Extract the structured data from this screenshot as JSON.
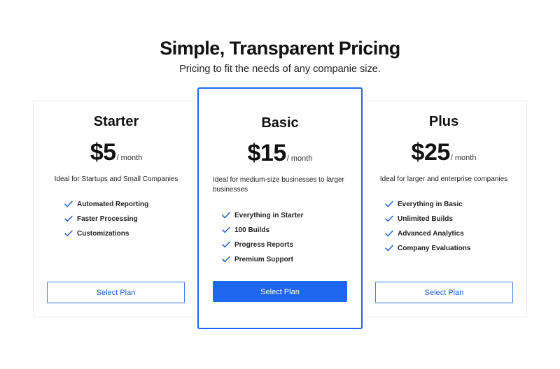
{
  "header": {
    "title": "Simple, Transparent Pricing",
    "subtitle": "Pricing to fit the needs of any companie size."
  },
  "colors": {
    "accent": "#1f66ef",
    "check": "#1f5fd6",
    "card_border": "#e7e9ec"
  },
  "plans": [
    {
      "name": "Starter",
      "price": "$5",
      "period": "/ month",
      "description": "Ideal for Startups and Small Companies",
      "features": [
        "Automated Reporting",
        "Faster Processing",
        "Customizations"
      ],
      "button_label": "Select Plan",
      "featured": false
    },
    {
      "name": "Basic",
      "price": "$15",
      "period": "/ month",
      "description": "Ideal for medium-size businesses to larger businesses",
      "features": [
        "Everything in Starter",
        "100 Builds",
        "Progress Reports",
        "Premium Support"
      ],
      "button_label": "Select Plan",
      "featured": true
    },
    {
      "name": "Plus",
      "price": "$25",
      "period": "/ month",
      "description": "Ideal for larger and enterprise companies",
      "features": [
        "Everything in Basic",
        "Unlimited Builds",
        "Advanced Analytics",
        "Company Evaluations"
      ],
      "button_label": "Select Plan",
      "featured": false
    }
  ]
}
